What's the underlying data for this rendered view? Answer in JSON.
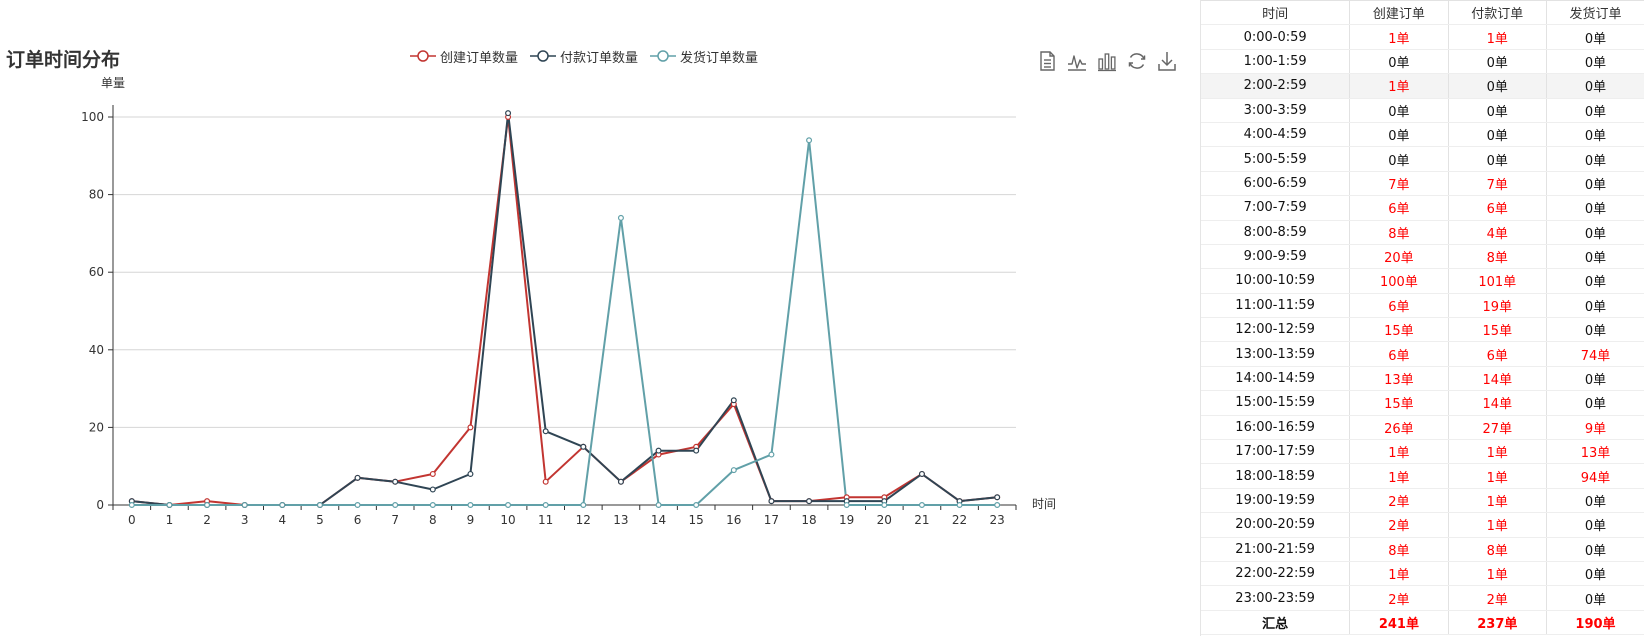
{
  "chart_data": {
    "type": "line",
    "title": "订单时间分布",
    "xlabel": "时间",
    "ylabel": "单量",
    "x": [
      "0",
      "1",
      "2",
      "3",
      "4",
      "5",
      "6",
      "7",
      "8",
      "9",
      "10",
      "11",
      "12",
      "13",
      "14",
      "15",
      "16",
      "17",
      "18",
      "19",
      "20",
      "21",
      "22",
      "23"
    ],
    "ylim": [
      0,
      100
    ],
    "yticks": [
      0,
      20,
      40,
      60,
      80,
      100
    ],
    "grid": true,
    "legend_position": "top-center",
    "series": [
      {
        "name": "创建订单数量",
        "color": "#c23531",
        "values": [
          1,
          0,
          1,
          0,
          0,
          0,
          7,
          6,
          8,
          20,
          100,
          6,
          15,
          6,
          13,
          15,
          26,
          1,
          1,
          2,
          2,
          8,
          1,
          2
        ]
      },
      {
        "name": "付款订单数量",
        "color": "#2f4554",
        "values": [
          1,
          0,
          0,
          0,
          0,
          0,
          7,
          6,
          4,
          8,
          101,
          19,
          15,
          6,
          14,
          14,
          27,
          1,
          1,
          1,
          1,
          8,
          1,
          2
        ]
      },
      {
        "name": "发货订单数量",
        "color": "#61a0a8",
        "values": [
          0,
          0,
          0,
          0,
          0,
          0,
          0,
          0,
          0,
          0,
          0,
          0,
          0,
          74,
          0,
          0,
          9,
          13,
          94,
          0,
          0,
          0,
          0,
          0
        ]
      }
    ]
  },
  "toolbox": {
    "icons": [
      "data-view-icon",
      "line-chart-icon",
      "bar-chart-icon",
      "restore-icon",
      "download-icon"
    ]
  },
  "table": {
    "headers": [
      "时间",
      "创建订单",
      "付款订单",
      "发货订单"
    ],
    "rows": [
      [
        "0:00-0:59",
        "1单",
        "1单",
        "0单"
      ],
      [
        "1:00-1:59",
        "0单",
        "0单",
        "0单"
      ],
      [
        "2:00-2:59",
        "1单",
        "0单",
        "0单"
      ],
      [
        "3:00-3:59",
        "0单",
        "0单",
        "0单"
      ],
      [
        "4:00-4:59",
        "0单",
        "0单",
        "0单"
      ],
      [
        "5:00-5:59",
        "0单",
        "0单",
        "0单"
      ],
      [
        "6:00-6:59",
        "7单",
        "7单",
        "0单"
      ],
      [
        "7:00-7:59",
        "6单",
        "6单",
        "0单"
      ],
      [
        "8:00-8:59",
        "8单",
        "4单",
        "0单"
      ],
      [
        "9:00-9:59",
        "20单",
        "8单",
        "0单"
      ],
      [
        "10:00-10:59",
        "100单",
        "101单",
        "0单"
      ],
      [
        "11:00-11:59",
        "6单",
        "19单",
        "0单"
      ],
      [
        "12:00-12:59",
        "15单",
        "15单",
        "0单"
      ],
      [
        "13:00-13:59",
        "6单",
        "6单",
        "74单"
      ],
      [
        "14:00-14:59",
        "13单",
        "14单",
        "0单"
      ],
      [
        "15:00-15:59",
        "15单",
        "14单",
        "0单"
      ],
      [
        "16:00-16:59",
        "26单",
        "27单",
        "9单"
      ],
      [
        "17:00-17:59",
        "1单",
        "1单",
        "13单"
      ],
      [
        "18:00-18:59",
        "1单",
        "1单",
        "94单"
      ],
      [
        "19:00-19:59",
        "2单",
        "1单",
        "0单"
      ],
      [
        "20:00-20:59",
        "2单",
        "1单",
        "0单"
      ],
      [
        "21:00-21:59",
        "8单",
        "8单",
        "0单"
      ],
      [
        "22:00-22:59",
        "1单",
        "1单",
        "0单"
      ],
      [
        "23:00-23:59",
        "2单",
        "2单",
        "0单"
      ]
    ],
    "highlighted_row": 2,
    "total": [
      "汇总",
      "241单",
      "237单",
      "190单"
    ],
    "zero_color": "#111111",
    "nonzero_color": "#ff0000"
  }
}
